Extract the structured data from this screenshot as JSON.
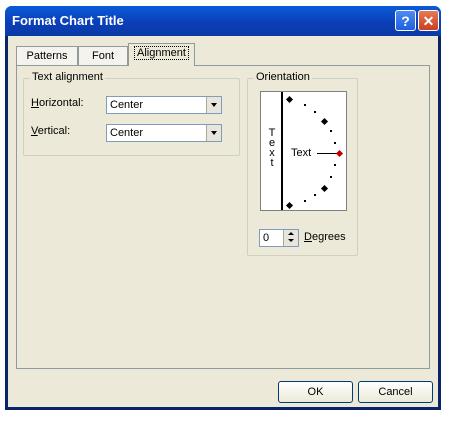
{
  "window": {
    "title": "Format Chart Title",
    "help_glyph": "?",
    "close_glyph": "✕"
  },
  "tabs": [
    {
      "label": "Patterns",
      "active": false
    },
    {
      "label": "Font",
      "active": false
    },
    {
      "label": "Alignment",
      "active": true
    }
  ],
  "text_alignment": {
    "group_label": "Text alignment",
    "horizontal_label_pre": "",
    "horizontal_label_ul": "H",
    "horizontal_label_post": "orizontal:",
    "horizontal_value": "Center",
    "vertical_label_ul": "V",
    "vertical_label_post": "ertical:",
    "vertical_value": "Center"
  },
  "orientation": {
    "group_label": "Orientation",
    "vertical_text": "T e x t",
    "dial_text": "Text",
    "degrees_value": "0",
    "degrees_label_ul": "D",
    "degrees_label_post": "egrees"
  },
  "footer": {
    "ok_label": "OK",
    "cancel_label": "Cancel"
  },
  "colors": {
    "accent_red": "#c00000",
    "titlebar_blue": "#0a3aa6"
  }
}
